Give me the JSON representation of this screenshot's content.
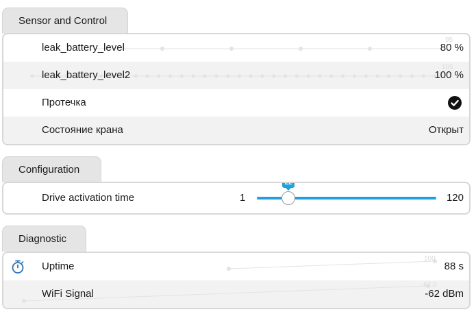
{
  "sections": {
    "sensor": {
      "title": "Sensor and Control",
      "rows": [
        {
          "label": "leak_battery_level",
          "value": "80 %",
          "spark_top": "95"
        },
        {
          "label": "leak_battery_level2",
          "value": "100 %",
          "spark_top": "105"
        },
        {
          "label": "Протечка",
          "icon": "check-circle-icon"
        },
        {
          "label": "Состояние крана",
          "value": "Открыт"
        }
      ]
    },
    "config": {
      "title": "Configuration",
      "slider": {
        "label": "Drive activation time",
        "min": "1",
        "max": "120",
        "value": "22"
      }
    },
    "diagnostic": {
      "title": "Diagnostic",
      "rows": [
        {
          "label": "Uptime",
          "value": "88 s",
          "icon": "stopwatch-icon",
          "spark_top": "100"
        },
        {
          "label": "WiFi Signal",
          "value": "-62 dBm",
          "spark_top": "-62.0"
        }
      ]
    }
  },
  "colors": {
    "accent": "#1ea1dc",
    "tab_bg": "#e5e5e5",
    "row_alt": "#f2f2f2",
    "border": "#d7d7d7"
  }
}
